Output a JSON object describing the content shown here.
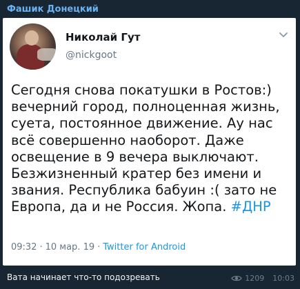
{
  "message": {
    "channel_name": "Фашик Донецкий",
    "caption": "Вата начинает что-то подозревать",
    "views": "1209",
    "time": "10:03",
    "view_icon": "eye-icon"
  },
  "tweet": {
    "author_name": "Николай Гут",
    "author_handle": "@nickgoot",
    "text": "Сегодня снова покатушки в Ростов:) вечерний город, полноценная жизнь, суета, постоянное движение. Ау нас всё совершенно наоборот. Даже освещение в 9 вечера выключают. Безжизненный кратер без имени и звания. Республика бабуин :( зато не Европа, да и не Россия. Жопа.",
    "hashtag": "#ДНР",
    "time": "09:32",
    "separator": "·",
    "date": "10 мар. 19",
    "source": "Twitter for Android",
    "menu_icon": "chevron-down-icon"
  },
  "colors": {
    "bubble_bg": "#182533",
    "channel_name": "#6ab3f3",
    "tweet_bg": "#ffffff",
    "tweet_text": "#14171a",
    "tweet_secondary": "#657786",
    "tweet_link": "#1b95e0",
    "caption_text": "#f5f5f5",
    "meta_text": "#6d7f8f"
  }
}
